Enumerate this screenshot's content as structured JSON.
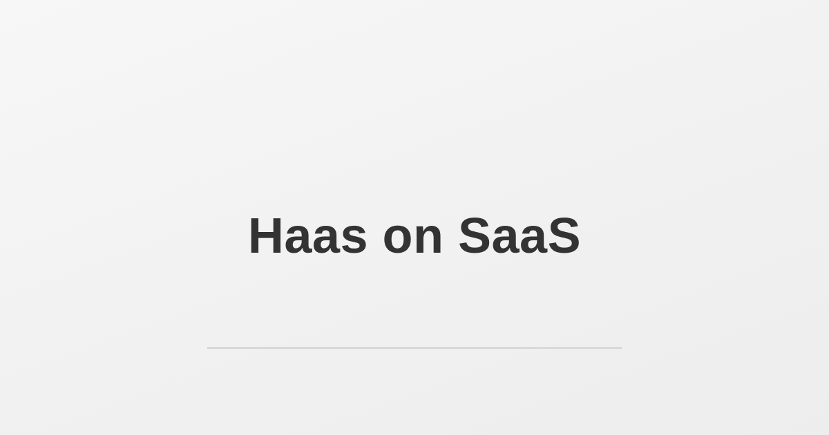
{
  "page": {
    "title": "Haas on SaaS"
  },
  "colors": {
    "title_text": "#333333",
    "divider": "#d2d2d2",
    "background": "#f2f2f2"
  }
}
